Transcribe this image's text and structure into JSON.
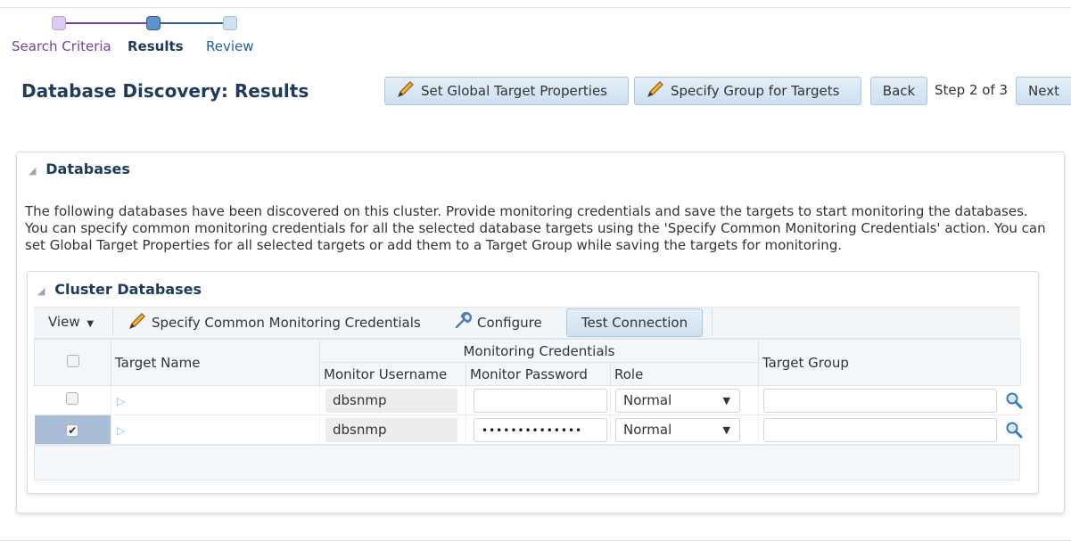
{
  "train": {
    "steps": [
      {
        "label": "Search Criteria",
        "state": "visited",
        "color": "#d9c9ee"
      },
      {
        "label": "Results",
        "state": "current",
        "color": "#5b8fc7"
      },
      {
        "label": "Review",
        "state": "unvisited",
        "color": "#c7ddf2"
      }
    ]
  },
  "header": {
    "title": "Database Discovery: Results",
    "buttons": {
      "set_global": "Set Global Target Properties",
      "specify_group": "Specify Group for Targets",
      "back": "Back",
      "step_info": "Step 2 of 3",
      "next": "Next"
    }
  },
  "databases_section": {
    "title": "Databases",
    "description": "The following databases have been discovered on this cluster. Provide monitoring credentials and save the targets to start monitoring the databases. You can specify common monitoring credentials for all the selected database targets using the 'Specify Common Monitoring Credentials' action. You can set Global Target Properties for all selected targets or add them to a Target Group while saving the targets for monitoring."
  },
  "cluster_databases": {
    "title": "Cluster Databases",
    "toolbar": {
      "view": "View",
      "specify_common": "Specify Common Monitoring Credentials",
      "configure": "Configure",
      "test_connection": "Test Connection"
    },
    "columns": {
      "target_name": "Target Name",
      "monitoring_credentials": "Monitoring Credentials",
      "monitor_username": "Monitor Username",
      "monitor_password": "Monitor Password",
      "role": "Role",
      "target_group": "Target Group"
    },
    "rows": [
      {
        "checked": false,
        "target_name": "",
        "monitor_username": "dbsnmp",
        "monitor_password": "",
        "role": "Normal",
        "target_group": ""
      },
      {
        "checked": true,
        "target_name": "",
        "monitor_username": "dbsnmp",
        "monitor_password": "••••••••••••••",
        "role": "Normal",
        "target_group": ""
      }
    ]
  },
  "colors": {
    "accent": "#1f3b5c",
    "button_bg": "#d6e6f5",
    "selected_row": "#a9bdd6"
  }
}
